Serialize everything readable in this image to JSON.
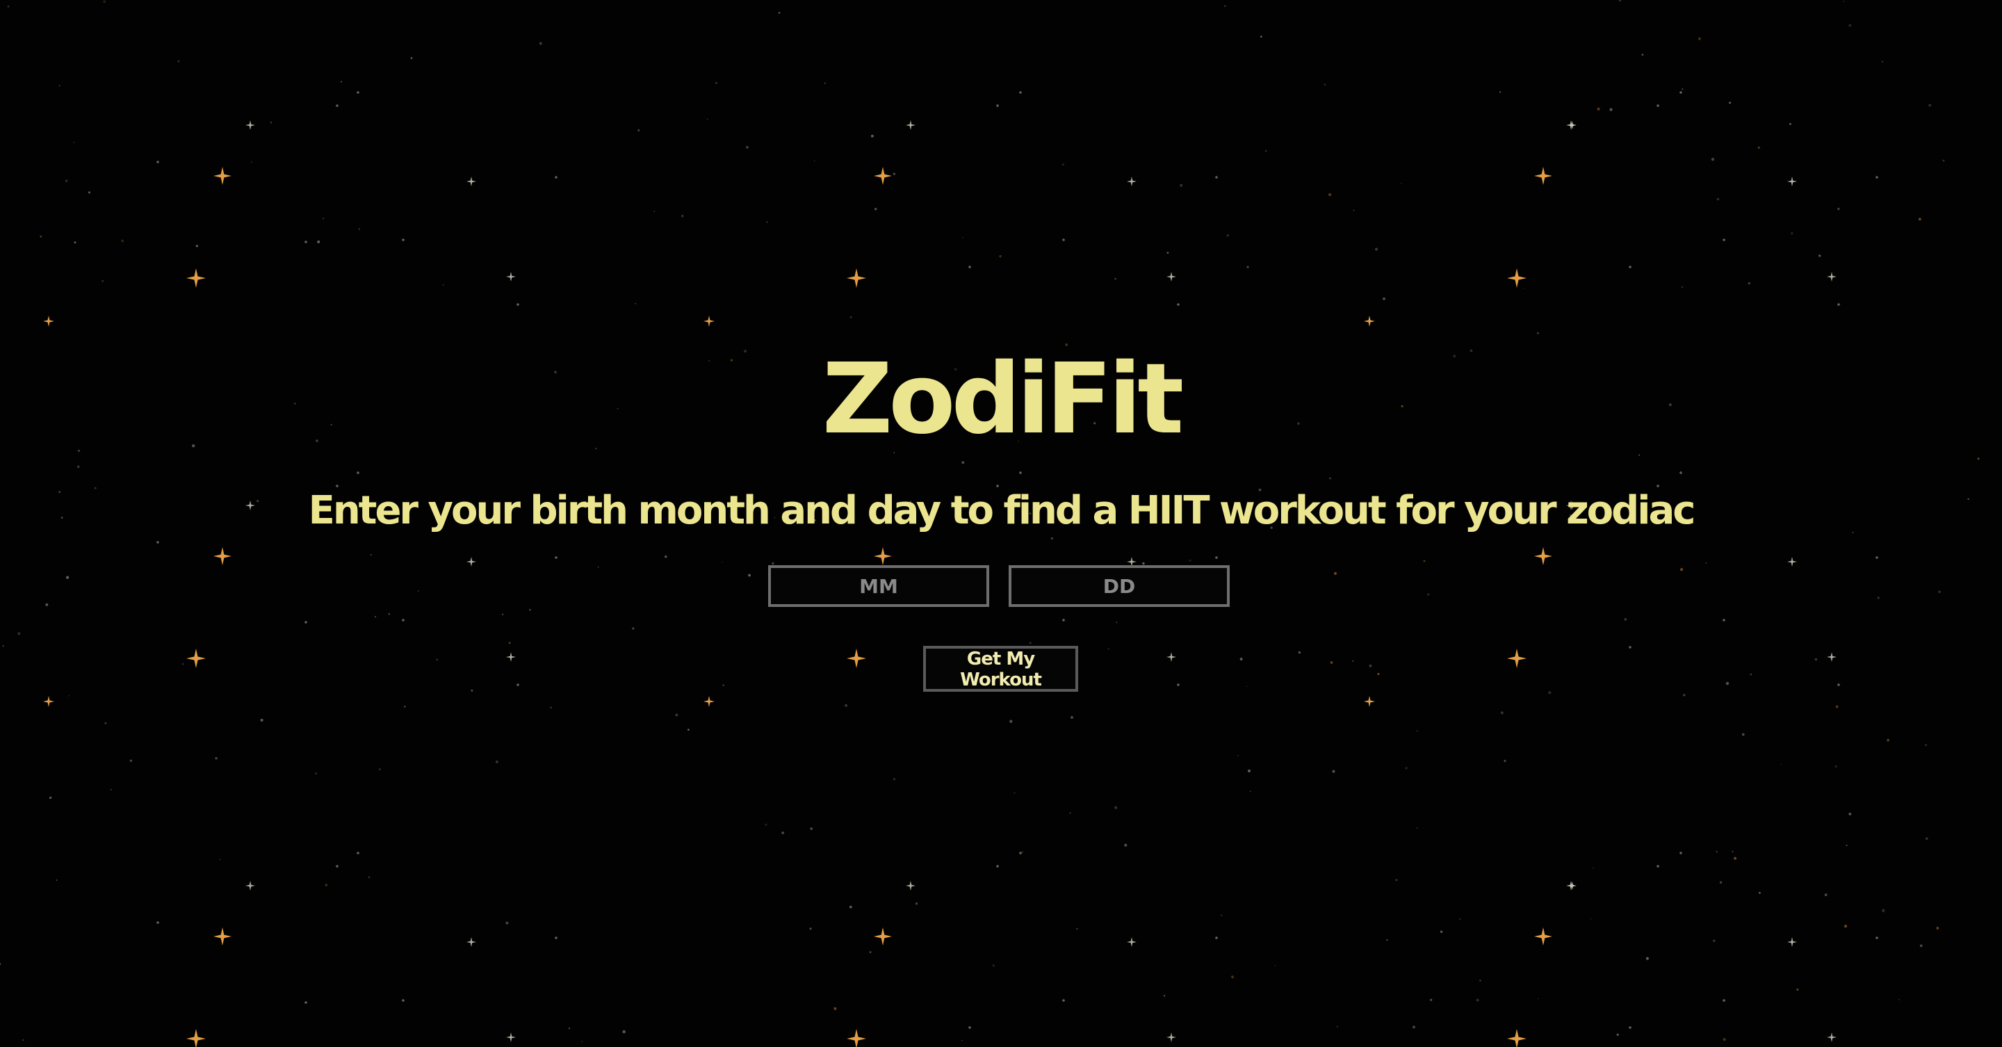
{
  "app": {
    "title": "ZodiFit",
    "subtitle": "Enter your birth month and day to find a HIIT workout for your zodiac"
  },
  "form": {
    "month": {
      "value": "",
      "placeholder": "MM"
    },
    "day": {
      "value": "",
      "placeholder": "DD"
    },
    "submit_label": "Get My Workout"
  },
  "theme": {
    "background": "#020202",
    "accent_text": "#ece58f",
    "star_gold": "#f0a64a",
    "star_white": "#d8d8c8",
    "input_border": "#6e6e6e"
  },
  "background_decoration": "star-field"
}
